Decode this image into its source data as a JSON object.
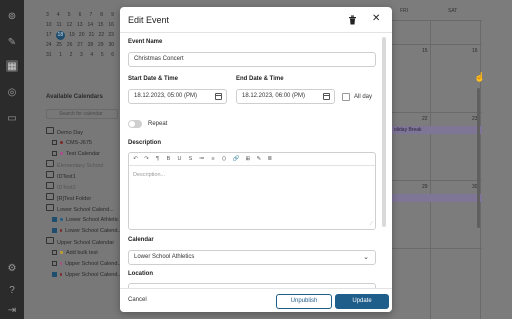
{
  "mini_calendar": {
    "rows": [
      [
        "",
        "",
        "",
        "",
        "",
        "",
        "",
        ""
      ],
      [
        "3",
        "4",
        "5",
        "6",
        "7",
        "8",
        "9"
      ],
      [
        "10",
        "11",
        "12",
        "13",
        "14",
        "15",
        "16"
      ],
      [
        "17",
        "18",
        "19",
        "20",
        "21",
        "22",
        "23"
      ],
      [
        "24",
        "25",
        "26",
        "27",
        "28",
        "29",
        "30"
      ],
      [
        "31",
        "1",
        "2",
        "3",
        "4",
        "5",
        "6"
      ]
    ],
    "selected": "18"
  },
  "sidebar": {
    "title": "Available Calendars",
    "search_placeholder": "Search for calendar",
    "items": [
      {
        "label": "Demo Day",
        "kind": "folder"
      },
      {
        "label": "CMS-J675",
        "kind": "item",
        "checked": false,
        "dot": "#7a2a2a"
      },
      {
        "label": "Test Calendar",
        "kind": "item",
        "checked": false,
        "dot": "#b04a8c"
      },
      {
        "label": "Elementary School",
        "kind": "folder-muted"
      },
      {
        "label": "IDTest1",
        "kind": "folder"
      },
      {
        "label": "IDTest2",
        "kind": "folder-muted"
      },
      {
        "label": "[R]Test Folder",
        "kind": "folder"
      },
      {
        "label": "Lower School Calend...",
        "kind": "folder"
      },
      {
        "label": "Lower School Athletic",
        "kind": "item",
        "checked": true,
        "dot": "#1f5d8a"
      },
      {
        "label": "Lower School Calend...",
        "kind": "item",
        "checked": true,
        "dot": "#7a2a2a"
      },
      {
        "label": "Upper School Calendar",
        "kind": "folder"
      },
      {
        "label": "Add bulk test",
        "kind": "item",
        "checked": false,
        "dot": "#c0a030"
      },
      {
        "label": "Upper School Calend...",
        "kind": "item",
        "checked": false,
        "dot": "#b04a8c"
      },
      {
        "label": "Upper School Calend...",
        "kind": "item",
        "checked": true,
        "dot": "#7a2a2a"
      }
    ]
  },
  "grid": {
    "headers": {
      "fri": "FRI",
      "sat": "SAT"
    },
    "day_15": "15",
    "day_16": "16",
    "day_22": "22",
    "day_23": "23",
    "day_29": "29",
    "day_30": "30",
    "event_label": "oliday Break"
  },
  "modal": {
    "title": "Edit Event",
    "event_name_label": "Event Name",
    "event_name_value": "Christmas Concert",
    "start_label": "Start Date & Time",
    "start_value": "18.12.2023, 05:00 (PM)",
    "end_label": "End Date & Time",
    "end_value": "18.12.2023, 06:00 (PM)",
    "allday_label": "All day",
    "repeat_label": "Repeat",
    "description_label": "Description",
    "description_placeholder": "Description...",
    "toolbar": [
      "↶",
      "↷",
      "¶",
      "B",
      "U",
      "S",
      "≔",
      "≡",
      "⟨⟩",
      "🔗",
      "⊞",
      "✎",
      "≣"
    ],
    "calendar_label": "Calendar",
    "calendar_value": "Lower School Athletics",
    "location_label": "Location",
    "cancel_label": "Cancel",
    "unpublish_label": "Unpublish",
    "update_label": "Update"
  }
}
